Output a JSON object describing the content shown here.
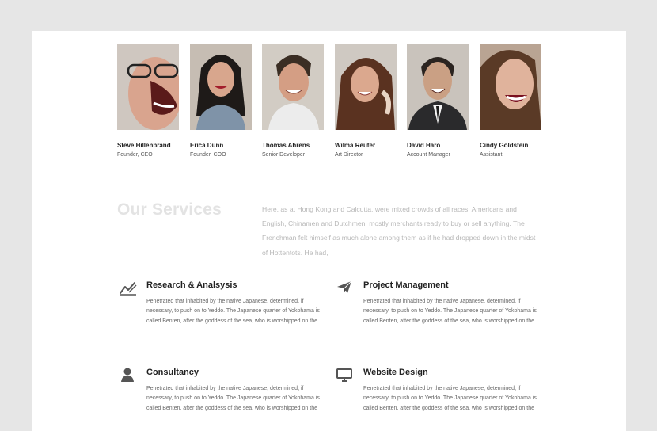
{
  "team": {
    "members": [
      {
        "name": "Steve Hillenbrand",
        "role": "Founder, CEO"
      },
      {
        "name": "Erica Dunn",
        "role": "Founder, COO"
      },
      {
        "name": "Thomas Ahrens",
        "role": "Senior Developer"
      },
      {
        "name": "Wilma Reuter",
        "role": "Art Director"
      },
      {
        "name": "David Haro",
        "role": "Account Manager"
      },
      {
        "name": "Cindy Goldstein",
        "role": "Assistant"
      }
    ]
  },
  "services": {
    "title": "Our Services",
    "intro": "Here, as at Hong Kong and Calcutta, were mixed crowds of all races, Americans and English, Chinamen and Dutchmen, mostly merchants ready to buy or sell anything. The Frenchman felt himself as much alone among them as if he had dropped down in the midst of Hottentots. He had,",
    "items": [
      {
        "title": "Research & Analsysis",
        "icon": "chart-line-icon",
        "text": "Penetrated that inhabited by the native Japanese, determined, if necessary, to push on to Yeddo. The Japanese quarter of Yokohama is called Benten, after the goddess of the sea, who is worshipped on the"
      },
      {
        "title": "Project Management",
        "icon": "paper-plane-icon",
        "text": "Penetrated that inhabited by the native Japanese, determined, if necessary, to push on to Yeddo. The Japanese quarter of Yokohama is called Benten, after the goddess of the sea, who is worshipped on the"
      },
      {
        "title": "Consultancy",
        "icon": "user-icon",
        "text": "Penetrated that inhabited by the native Japanese, determined, if necessary, to push on to Yeddo. The Japanese quarter of Yokohama is called Benten, after the goddess of the sea, who is worshipped on the"
      },
      {
        "title": "Website Design",
        "icon": "monitor-icon",
        "text": "Penetrated that inhabited by the native Japanese, determined, if necessary, to push on to Yeddo. The Japanese quarter of Yokohama is called Benten, after the goddess of the sea, who is worshipped on the"
      }
    ]
  }
}
